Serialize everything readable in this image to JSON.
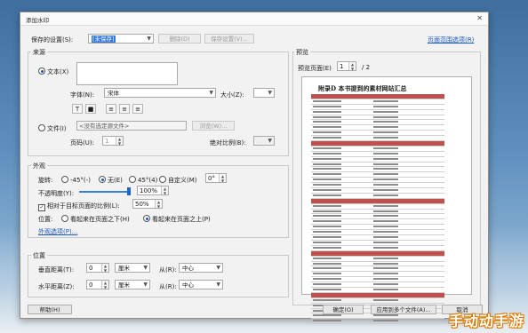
{
  "dialog": {
    "title": "添加水印",
    "close_icon": "✕"
  },
  "top": {
    "saved_settings_label": "保存的设置(S):",
    "saved_settings_value": "[未保存]",
    "delete_button": "删除(D)",
    "save_settings_button": "保存设置(V)...",
    "page_range_link": "页面范围选项(R)"
  },
  "source": {
    "group_label": "来源",
    "text_radio": "文本(X)",
    "font_label": "字体(N):",
    "font_value": "宋体",
    "size_label": "大小(Z):",
    "file_radio": "文件(I)",
    "file_placeholder": "<没有选定源文件>",
    "browse_button": "浏览(W)...",
    "page_number_label": "页码(U):",
    "page_number_value": "1",
    "absolute_scale_label": "绝对比例(B):",
    "text_format_buttons": [
      "T",
      "■"
    ]
  },
  "appearance": {
    "group_label": "外观",
    "rotation_label": "旋转:",
    "rot_neg45": "-45°(-)",
    "rot_none": "无(E)",
    "rot_45": "45°(4)",
    "rot_custom": "自定义(M)",
    "rot_custom_value": "0°",
    "opacity_label": "不透明度(Y):",
    "opacity_value": "100%",
    "opacity_level": 1.0,
    "relative_scale_label": "相对于目标页面的比例(L):",
    "relative_scale_value": "50%",
    "position_label": "位置:",
    "pos_behind": "看起来在页面之下(H)",
    "pos_front": "看起来在页面之上(P)",
    "appearance_options_link": "外观选项(P)..."
  },
  "position": {
    "group_label": "位置",
    "vertical_label": "垂直距离(T):",
    "vertical_value": "0",
    "vertical_unit": "厘米",
    "from_label_v": "从(R):",
    "vertical_from": "中心",
    "horizontal_label": "水平距离(Z):",
    "horizontal_value": "0",
    "horizontal_unit": "厘米",
    "from_label_h": "从(R):",
    "horizontal_from": "中心"
  },
  "preview": {
    "group_label": "预览",
    "page_label": "预览页面(E)",
    "page_value": "1",
    "page_total": "/ 2",
    "doc_title": "附录D  本书提到的素材网站汇总"
  },
  "footer": {
    "help_button": "帮助(H)",
    "ok_button": "确定(O)",
    "apply_multiple_button": "应用到多个文件(A)...",
    "cancel_button": "取消"
  },
  "watermark": {
    "text": "手动动手游"
  }
}
